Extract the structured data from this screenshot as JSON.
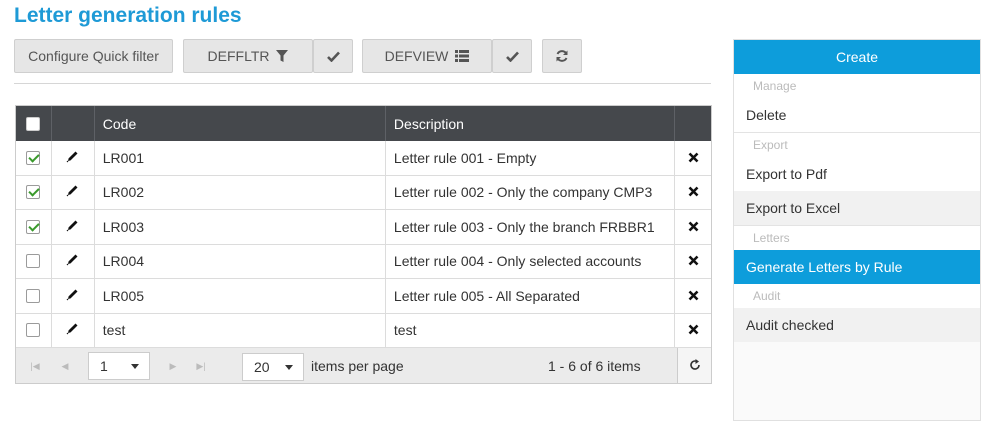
{
  "page": {
    "title": "Letter generation rules"
  },
  "toolbar": {
    "configure_label": "Configure Quick filter",
    "filter_label": "DEFFLTR",
    "view_label": "DEFVIEW",
    "icons": [
      "filter-icon",
      "check-icon",
      "list-icon",
      "check-icon",
      "refresh-icon"
    ]
  },
  "grid": {
    "columns": [
      "",
      "",
      "Code",
      "Description",
      ""
    ],
    "rows": [
      {
        "checked": true,
        "code": "LR001",
        "description": "Letter rule 001 - Empty"
      },
      {
        "checked": true,
        "code": "LR002",
        "description": "Letter rule 002 - Only the company CMP3"
      },
      {
        "checked": true,
        "code": "LR003",
        "description": "Letter rule 003 - Only the branch FRBBR1"
      },
      {
        "checked": false,
        "code": "LR004",
        "description": "Letter rule 004 - Only selected accounts"
      },
      {
        "checked": false,
        "code": "LR005",
        "description": "Letter rule 005 - All Separated"
      },
      {
        "checked": false,
        "code": "test",
        "description": "test"
      }
    ]
  },
  "pager": {
    "page": "1",
    "page_size": "20",
    "items_per_page_label": "items per page",
    "info": "1 - 6 of 6 items"
  },
  "actions": {
    "create_label": "Create",
    "manage_header": "Manage",
    "delete_label": "Delete",
    "export_header": "Export",
    "export_pdf_label": "Export to Pdf",
    "export_excel_label": "Export to Excel",
    "letters_header": "Letters",
    "generate_label": "Generate Letters by Rule",
    "audit_header": "Audit",
    "audit_checked_label": "Audit checked"
  },
  "colors": {
    "accent": "#0d9ddb",
    "title": "#1e9ad6",
    "header_bg": "#45484c",
    "check": "#3a9a2c"
  }
}
